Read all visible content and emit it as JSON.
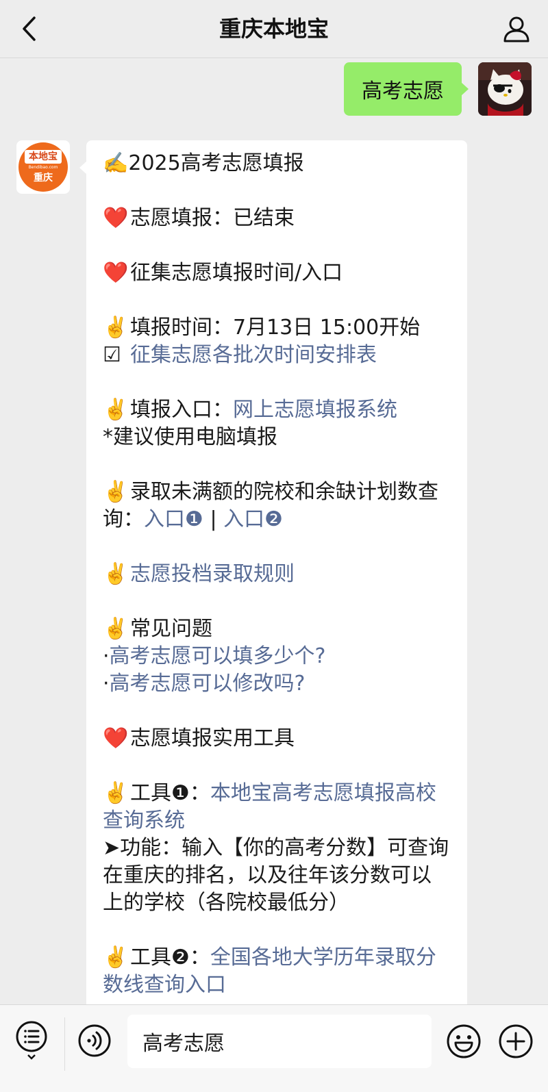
{
  "header": {
    "title": "重庆本地宝"
  },
  "chat": {
    "outgoing": {
      "text": "高考志愿"
    },
    "logo": {
      "top": "本地宝",
      "mid": "Bendibao.com",
      "bottom": "重庆"
    },
    "incoming": {
      "l1": "✍️2025高考志愿填报",
      "l2": "志愿填报：已结束",
      "l3": "征集志愿填报时间/入口",
      "l4": "填报时间：7月13日 15:00开始",
      "l5_box": "☑",
      "l5_link": "征集志愿各批次时间安排表",
      "l6_text": "填报入口：",
      "l6_link": "网上志愿填报系统",
      "l7": "*建议使用电脑填报",
      "l8": "录取未满额的院校和余缺计划数查询：",
      "l8_link1": "入口❶",
      "l8_sep": " | ",
      "l8_link2": "入口❷",
      "l9_link": "志愿投档录取规则",
      "l10": "常见问题",
      "l11_dot": "·",
      "l11_link": "高考志愿可以填多少个?",
      "l12_dot": "·",
      "l12_link": "高考志愿可以修改吗?",
      "l13": "志愿填报实用工具",
      "l14_text": "工具❶：",
      "l14_link": "本地宝高考志愿填报高校查询系统",
      "l15": "➤功能：输入【你的高考分数】可查询在重庆的排名，以及往年该分数可以上的学校（各院校最低分）",
      "l16_text": "工具❷：",
      "l16_link": "全国各地大学历年录取分数线查询入口",
      "emoji_heart": "❤️",
      "emoji_victory": "✌️"
    }
  },
  "input": {
    "text": "高考志愿"
  },
  "icons": [
    "back-icon",
    "profile-icon",
    "menu-list-icon",
    "voice-icon",
    "emoji-icon",
    "plus-icon"
  ],
  "colors": {
    "background": "#ededed",
    "outgoing_bubble": "#95ec69",
    "link": "#576b95",
    "logo": "#ee6a1c"
  }
}
